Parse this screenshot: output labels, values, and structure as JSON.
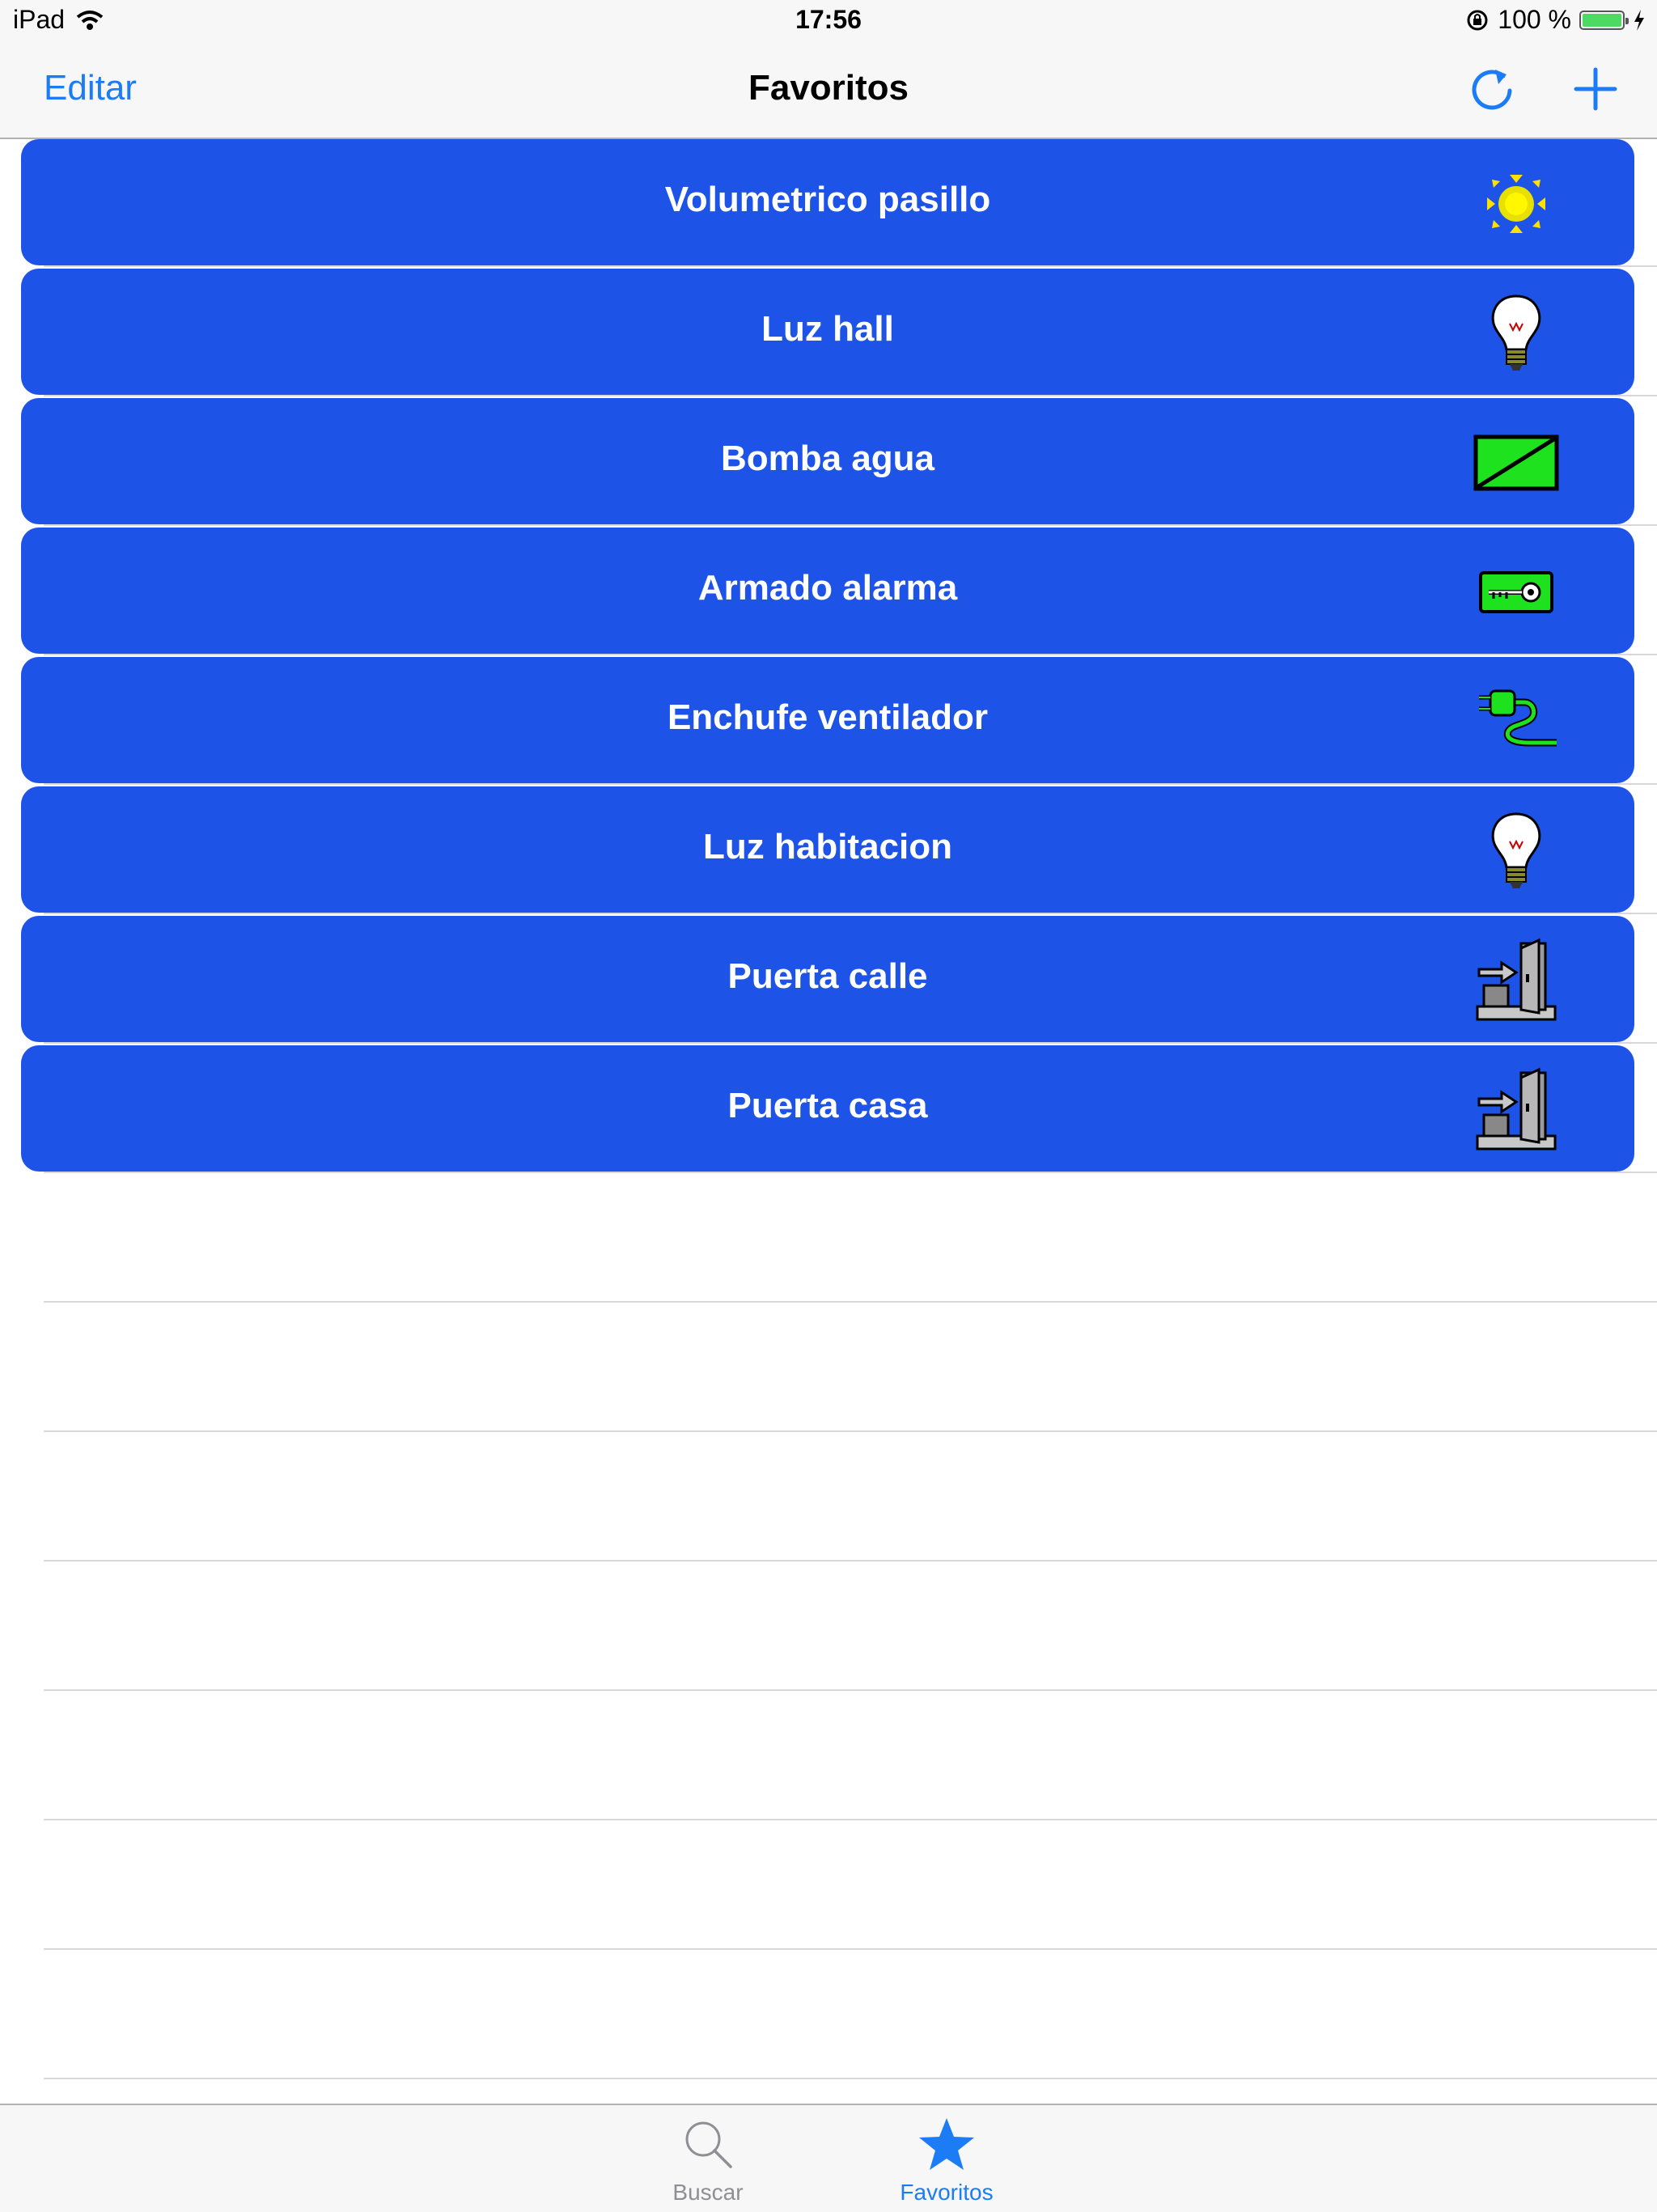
{
  "status_bar": {
    "device": "iPad",
    "time": "17:56",
    "battery": "100 %"
  },
  "nav": {
    "edit_label": "Editar",
    "title": "Favoritos",
    "refresh_icon": "refresh-icon",
    "add_icon": "plus-icon"
  },
  "favorites": [
    {
      "label": "Volumetrico pasillo",
      "icon": "motion-sensor-icon"
    },
    {
      "label": "Luz hall",
      "icon": "lightbulb-icon"
    },
    {
      "label": "Bomba agua",
      "icon": "pump-switch-icon"
    },
    {
      "label": "Armado alarma",
      "icon": "alarm-key-icon"
    },
    {
      "label": "Enchufe ventilador",
      "icon": "plug-icon"
    },
    {
      "label": "Luz habitacion",
      "icon": "lightbulb-icon"
    },
    {
      "label": "Puerta calle",
      "icon": "door-icon"
    },
    {
      "label": "Puerta casa",
      "icon": "door-icon"
    }
  ],
  "tabs": [
    {
      "label": "Buscar",
      "icon": "search-icon",
      "active": false
    },
    {
      "label": "Favoritos",
      "icon": "star-icon",
      "active": true
    }
  ],
  "colors": {
    "accent": "#1b7cf5",
    "button_blue": "#1e53e8",
    "inactive_tab": "#8e8e93"
  }
}
